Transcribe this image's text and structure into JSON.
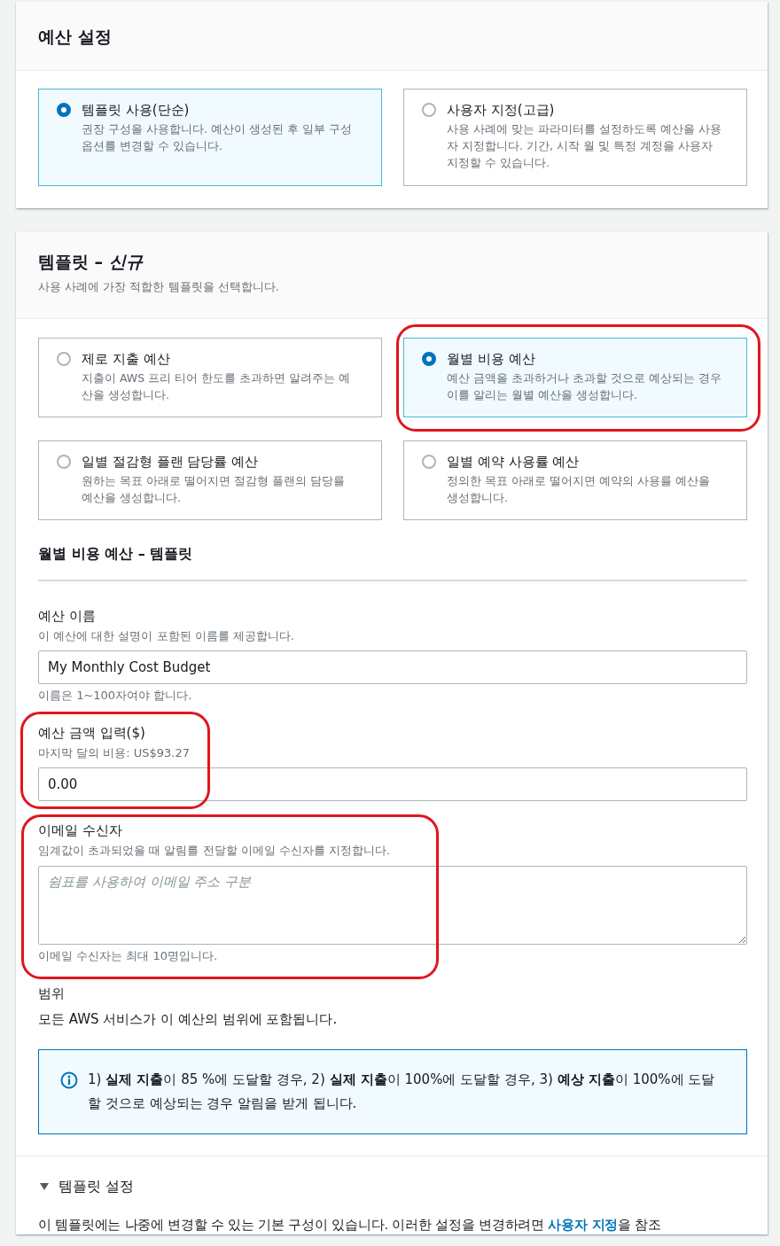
{
  "budget_setup": {
    "title": "예산 설정",
    "options": [
      {
        "label": "템플릿 사용(단순)",
        "description": "권장 구성을 사용합니다. 예산이 생성된 후 일부 구성 옵션를 변경할 수 있습니다.",
        "selected": true,
        "highlighted": false
      },
      {
        "label": "사용자 지정(고급)",
        "description": "사용 사례에 맞는 파라미터를 설정하도록 예산을 사용자 지정합니다. 기간, 시작 월 및 특정 계정을 사용자 지정할 수 있습니다.",
        "selected": false,
        "highlighted": false
      }
    ]
  },
  "templates": {
    "title": "템플릿 – *신규*",
    "subtitle": "사용 사례에 가장 적합한 템플릿을 선택합니다.",
    "options": [
      {
        "label": "제로 지출 예산",
        "description": "지출이 AWS 프리 티어 한도를 초과하면 알려주는 예산을 생성합니다.",
        "selected": false,
        "highlighted": false
      },
      {
        "label": "월별 비용 예산",
        "description": "예산 금액을 초과하거나 초과할 것으로 예상되는 경우 이를 알리는 월별 예산을 생성합니다.",
        "selected": true,
        "highlighted": true
      },
      {
        "label": "일별 절감형 플랜 담당률 예산",
        "description": "원하는 목표 아래로 떨어지면 절감형 플랜의 담당률 예산을 생성합니다.",
        "selected": false,
        "highlighted": false
      },
      {
        "label": "일별 예약 사용률 예산",
        "description": "정의한 목표 아래로 떨어지면 예약의 사용률 예산을 생성합니다.",
        "selected": false,
        "highlighted": false
      }
    ]
  },
  "form": {
    "title": "월별 비용 예산 – 템플릿",
    "fields": [
      {
        "kind": "input",
        "label": "예산 이름",
        "description": "이 예산에 대한 설명이 포함된 이름를 제공합니다.",
        "value": "My Monthly Cost Budget",
        "hint": "이름은 1~100자여야 합니다.",
        "highlighted": false
      },
      {
        "kind": "input",
        "label": "예산 금액 입력($)",
        "description": "마지막 달의 비용: US$93.27",
        "value": "0.00",
        "highlighted": true
      },
      {
        "kind": "textarea",
        "label": "이메일 수신자",
        "description": "임계값이 초과되었을 때 알림를 전달할 이메일 수신자를 지정합니다.",
        "placeholder": "쉼표를 사용하여 이메일 주소 구분",
        "hint": "이메일 수신자는 최대 10명입니다.",
        "highlighted": true
      }
    ],
    "scope": {
      "label": "범위",
      "text": "모든 AWS 서비스가 이 예산의 범위에 포함됩니다."
    },
    "info": {
      "text": "1) **실제 지출**이 85 %에 도달할 경우, 2) **실제 지출**이 100%에 도달할 경우, 3) **예상 지출**이 100%에 도달할 것으로 예상되는 경우 알림을 받게 됩니다."
    }
  },
  "template_settings": {
    "title": "템플릿 설정",
    "expanded": true,
    "text_before": "이 템플릿에는 나중에 변경할 수 있는 기본 구성이 있습니다. 이러한 설정을 변경하려면 ",
    "link": "사용자 지정",
    "text_after": "을 참조"
  }
}
